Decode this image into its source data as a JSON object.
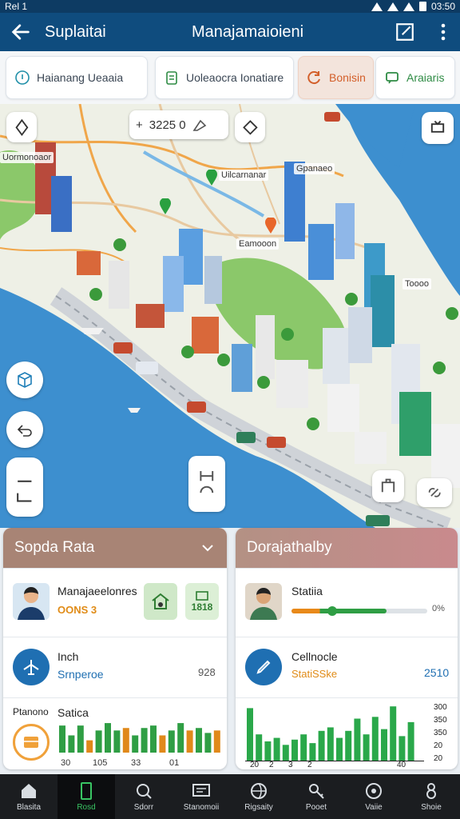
{
  "status_bar": {
    "carrier": "Rel 1",
    "time": "03:50"
  },
  "app_bar": {
    "subtitle": "Suplaitai",
    "title": "Manajamaioieni"
  },
  "chips": [
    {
      "label": "Haianang Ueaaia",
      "icon": "info-icon"
    },
    {
      "label": "Uoleaocra Ionatiare",
      "icon": "clipboard-icon"
    },
    {
      "label": "Bonisin",
      "icon": "refresh-icon",
      "color": "#d35f2a"
    },
    {
      "label": "Araiaris",
      "icon": "message-icon",
      "color": "#2e8b44"
    }
  ],
  "map": {
    "zoom_value": "3225 0",
    "labels": [
      "Uormonoaor",
      "Uilcarnanar",
      "Eamooon",
      "Gpanaeo",
      "Toooo"
    ]
  },
  "left_panel": {
    "title": "Sopda Rata",
    "row1": {
      "name": "Manajaeelonres",
      "value": "OONS 3",
      "tile_value": "1818"
    },
    "row2": {
      "label": "Inch",
      "sub": "Srnperoe",
      "value": "928"
    },
    "row3": {
      "label": "Ptanono",
      "sub": "Satica"
    },
    "chart_data": {
      "type": "bar",
      "x_ticks": [
        "30",
        "105",
        "33",
        "01"
      ],
      "series": [
        {
          "values": [
            22,
            14,
            22,
            10,
            18,
            24,
            18,
            20,
            14,
            20,
            22,
            14,
            18,
            24,
            18,
            20,
            16,
            18
          ],
          "colors": [
            "#2f9e44",
            "#2f9e44",
            "#2f9e44",
            "#e0891a",
            "#2f9e44",
            "#2f9e44",
            "#2f9e44",
            "#e0891a",
            "#2f9e44",
            "#2f9e44",
            "#2f9e44",
            "#e0891a",
            "#2f9e44",
            "#2f9e44",
            "#e0891a",
            "#2f9e44",
            "#2f9e44",
            "#e0891a"
          ]
        }
      ]
    }
  },
  "right_panel": {
    "title": "Dorajathalby",
    "row1": {
      "name": "Statiia",
      "pct": "0%",
      "progress": 0.7
    },
    "row2": {
      "label": "Cellnocle",
      "sub": "StatiSSke",
      "value": "2510"
    },
    "chart_data": {
      "type": "bar",
      "x_ticks": [
        "20",
        "2",
        "3",
        "2",
        "40"
      ],
      "y_ticks": [
        "300",
        "350",
        "350",
        "20",
        "20"
      ],
      "series": [
        {
          "values": [
            60,
            30,
            22,
            26,
            18,
            24,
            30,
            20,
            34,
            38,
            26,
            34,
            48,
            30,
            50,
            36,
            62,
            28,
            44
          ]
        }
      ]
    }
  },
  "bottom_nav": [
    {
      "label": "Blasita",
      "icon": "home-icon"
    },
    {
      "label": "Rosd",
      "icon": "phone-icon",
      "active": true
    },
    {
      "label": "Sdorr",
      "icon": "search-icon"
    },
    {
      "label": "Stanomoii",
      "icon": "screen-icon"
    },
    {
      "label": "Rigsaity",
      "icon": "globe-icon"
    },
    {
      "label": "Pooet",
      "icon": "key-icon"
    },
    {
      "label": "Vaiie",
      "icon": "target-icon"
    },
    {
      "label": "Shoie",
      "icon": "eight-icon"
    }
  ]
}
